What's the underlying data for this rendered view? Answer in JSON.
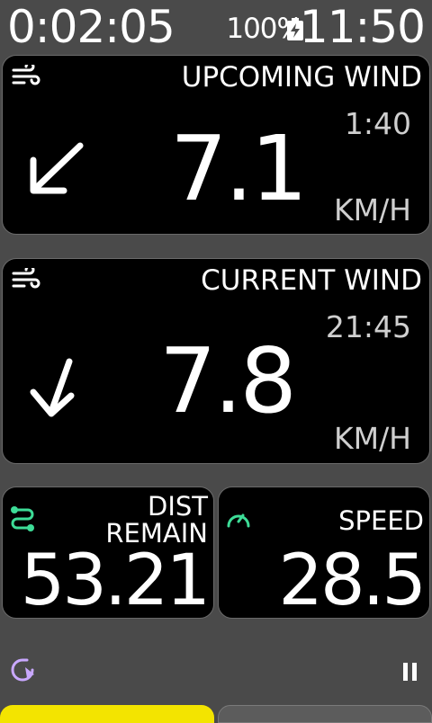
{
  "status": {
    "timer": "0:02:05",
    "battery_percent": "100%",
    "battery_icon": "battery-charging-icon",
    "clock": "11:50"
  },
  "upcoming_wind": {
    "title": "UPCOMING WIND",
    "time": "1:40",
    "value": "7.1",
    "unit": "KM/H",
    "icon": "wind-icon",
    "direction_icon": "arrow-down-left-icon"
  },
  "current_wind": {
    "title": "CURRENT WIND",
    "time": "21:45",
    "value": "7.8",
    "unit": "KM/H",
    "icon": "wind-icon",
    "direction_icon": "arrow-down-left-icon"
  },
  "dist_remain": {
    "title_line1": "DIST",
    "title_line2": "REMAIN",
    "value": "53.21",
    "icon": "route-icon",
    "accent": "#3ddc97"
  },
  "speed": {
    "title": "SPEED",
    "value": "28.5",
    "icon": "speedometer-icon",
    "accent": "#3ddc97"
  },
  "footer": {
    "refresh_icon": "refresh-icon",
    "refresh_color": "#c9a8ff",
    "pause_icon": "pause-icon",
    "active_tab_color": "#f3e400"
  }
}
